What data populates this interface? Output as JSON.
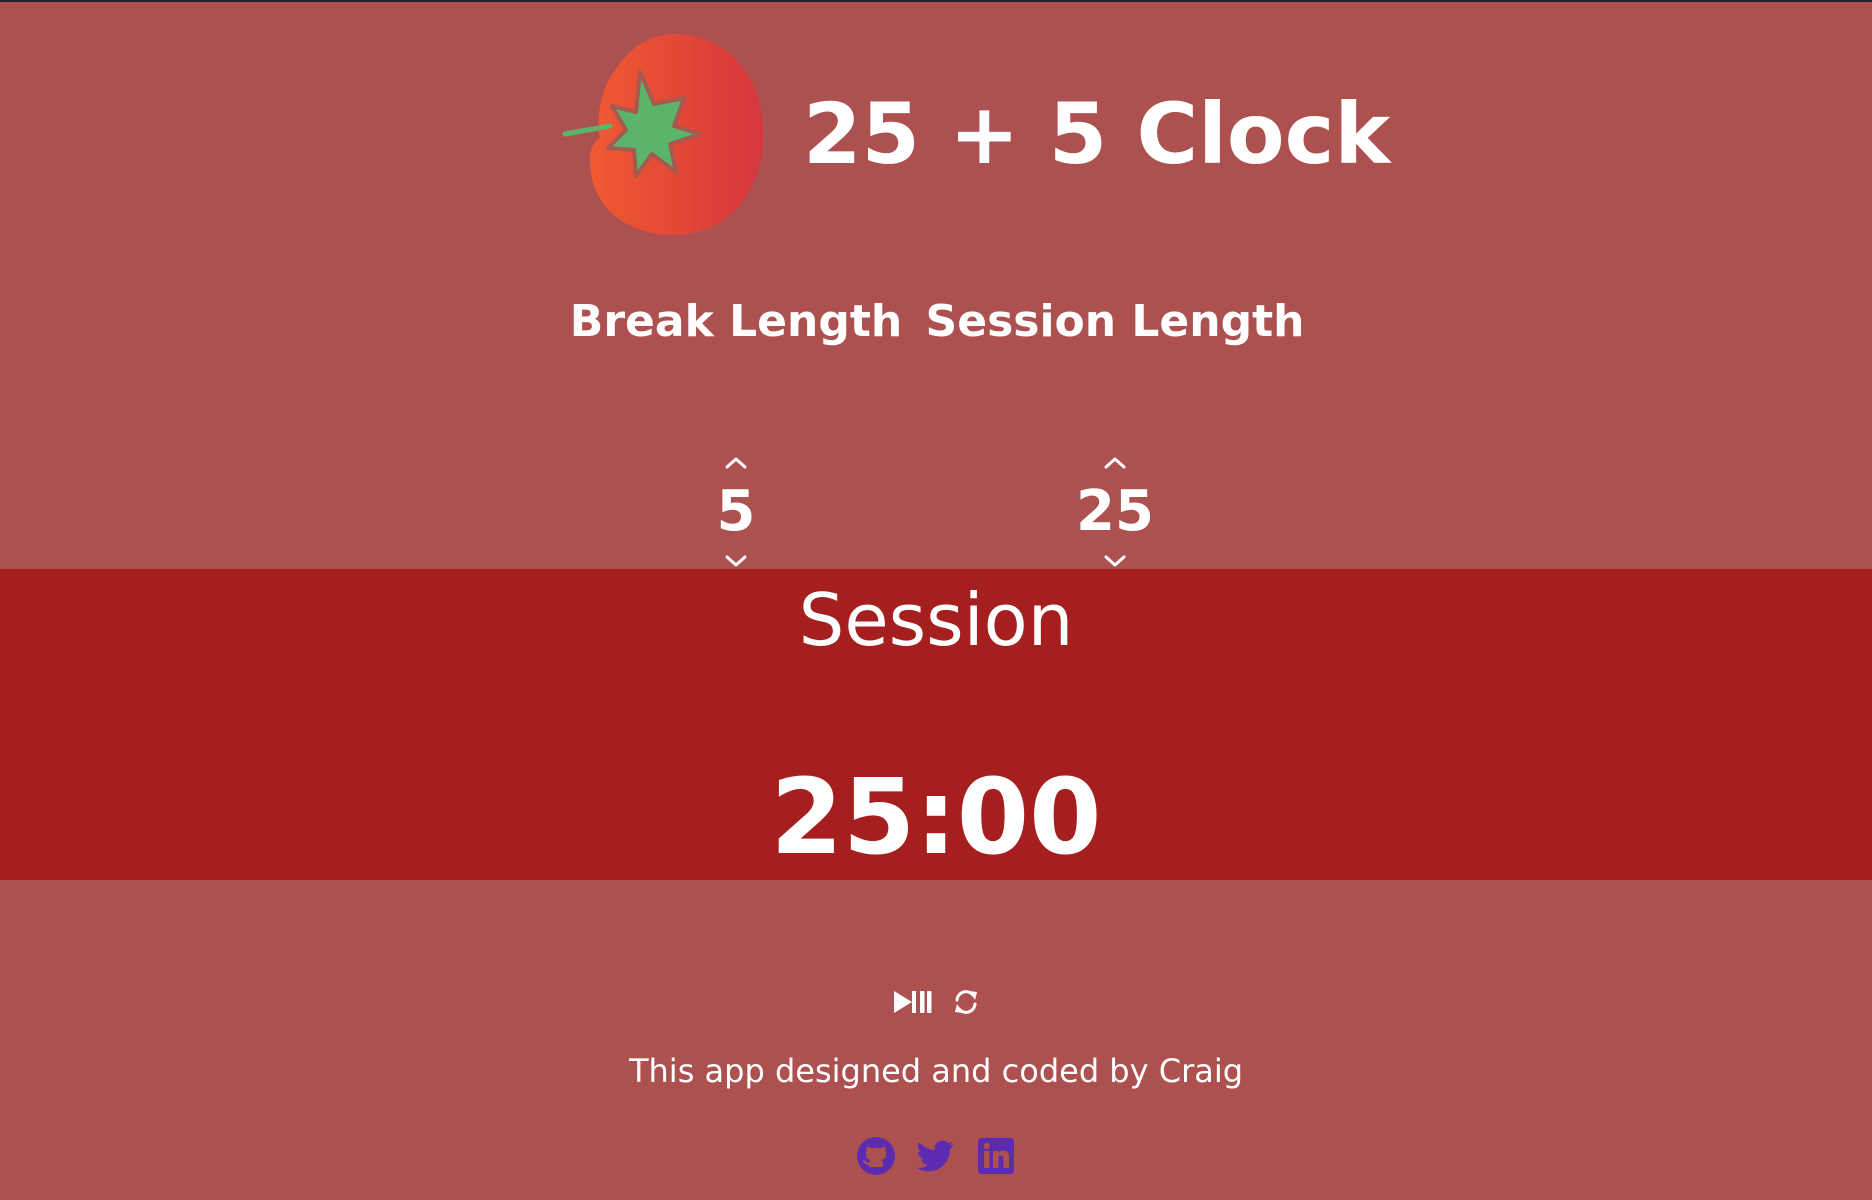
{
  "header": {
    "title": "25 + 5 Clock",
    "logo_icon": "tomato-icon"
  },
  "break_control": {
    "label": "Break Length",
    "value": "5",
    "increment_icon": "chevron-up-icon",
    "decrement_icon": "chevron-down-icon"
  },
  "session_control": {
    "label": "Session Length",
    "value": "25",
    "increment_icon": "chevron-up-icon",
    "decrement_icon": "chevron-down-icon"
  },
  "timer": {
    "label": "Session",
    "time_left": "25:00"
  },
  "controls": {
    "start_stop_icon": "play-pause-icon",
    "reset_icon": "refresh-icon"
  },
  "footer": {
    "credit": "This app designed and coded by Craig",
    "social": [
      {
        "name": "github-icon"
      },
      {
        "name": "twitter-icon"
      },
      {
        "name": "linkedin-icon"
      }
    ]
  },
  "colors": {
    "page_background": "#ad5150",
    "timer_background": "#a51f1e",
    "text": "#ffffff",
    "social_icons": "#5b2bb0",
    "tomato_body": "#e0453c",
    "tomato_leaf": "#5ab46a"
  }
}
